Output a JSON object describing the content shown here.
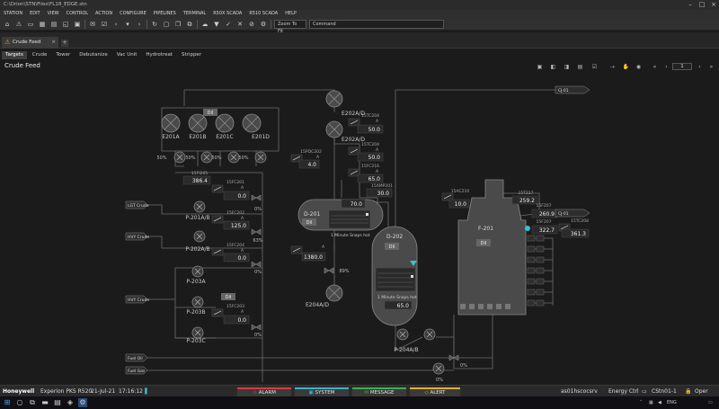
{
  "window": {
    "title": "C:\\Orion\\STN\\Files\\FL18_EDGE.stn"
  },
  "menu": [
    "STATION",
    "EDIT",
    "VIEW",
    "CONTROL",
    "ACTION",
    "CONFIGURE",
    "PIPELINES",
    "TERMINAL",
    "R50X SCADA",
    "R510 SCADA",
    "HELP"
  ],
  "toolbar": {
    "zoom": "Zoom To Fit",
    "command_placeholder": "Command"
  },
  "doc_tab": {
    "label": "Crude Feed"
  },
  "nav_tabs": [
    "Targets",
    "Crude",
    "Tower",
    "Debutanize",
    "Vac Unit",
    "Hydrotreat",
    "Stripper"
  ],
  "page": {
    "title": "Crude Feed",
    "number": "1"
  },
  "colors": {
    "background": "#1b1b1b",
    "line": "#6e6e6e",
    "equipment": "#4a4a4a",
    "value_box": "#2a2a2a",
    "accent_cyan": "#39c1d2",
    "alarm_red": "#d83b3b",
    "system_cyan": "#3bb2c7",
    "message_green": "#3cb04c",
    "alert_yellow": "#e0b030"
  },
  "schematic": {
    "exchangers_e201": [
      {
        "label": "E201A",
        "pct": "50%"
      },
      {
        "label": "E201B",
        "pct": "50%"
      },
      {
        "label": "E201C",
        "pct": "50%"
      },
      {
        "label": "E201D",
        "pct": "50%"
      }
    ],
    "e201_dil": "Dil",
    "tags": {
      "t15fi205": "15FI205",
      "t15fc201": "15FC201",
      "t15fc202": "15FC202",
      "t15fc203": "15FC203",
      "t15fc204": "15FC204",
      "t15pdc202": "15PDC202",
      "t15tc204": "15TC204",
      "t15fc216": "15FC216",
      "t15amp201": "15AMP201",
      "t15ac210": "15AC210",
      "t15t227": "15T227",
      "t15f207": "15F207",
      "t15tc208": "15TC208"
    },
    "values": {
      "fi205": "386.4",
      "fc201": "0.0",
      "fc202": "125.0",
      "fc203": "0.0",
      "fc204": "0.0",
      "pdc202": "4.0",
      "tc204_top": "50.0",
      "tc204_mid": "50.0",
      "fc216": "65.0",
      "amp201": "30.0",
      "d201_level": "70.0",
      "d201_out": "1380.0",
      "d202_level": "65.0",
      "ac210": "10.0",
      "t227": "259.2",
      "f_a": "260.9",
      "f_b": "322.7",
      "tc208": "361.3"
    },
    "pcts": {
      "fc201_out": "0%",
      "fc202_out": "63%",
      "fc204_out": "0%",
      "fc203_out": "0%",
      "d201_valve": "89%",
      "fuel_oil": "0%",
      "fuel_gas": "0%"
    },
    "ab": "A",
    "inlets": [
      "LGT Crude",
      "HVY Crude",
      "HVY Crude"
    ],
    "pumps": [
      "P-201A/B",
      "P-202A/B",
      "P-203A",
      "P-203B",
      "P-203C",
      "P-204A/B"
    ],
    "p203_dil": "Dil",
    "e202a": "E202A/D",
    "e202b": "E202A/D",
    "e204": "E204A/D",
    "d201": {
      "label": "D-201",
      "dil": "Dil",
      "trend": "1 Minute Snaps hot"
    },
    "d202": {
      "label": "D-202",
      "dil": "Dil",
      "trend": "1 Minute Snaps hot"
    },
    "f201": {
      "label": "F-201",
      "dil": "Dil"
    },
    "offpage": [
      "CJ-01",
      "CJ-01"
    ],
    "fuel": [
      "Fuel Oil",
      "Fuel Gas"
    ]
  },
  "statusbar": {
    "brand": "Honeywell",
    "product": "Experion PKS R520",
    "date": "21-Jul-21",
    "time": "17:16:12",
    "alarm": "ALARM",
    "system": "SYSTEM",
    "message": "MESSAGE",
    "alert": "ALERT",
    "operator": "as01hscocsrv",
    "asset": "Energy Ctrl",
    "station": "CStn01-1",
    "mode": "Oper"
  },
  "taskbar": {
    "lang": "ENG"
  }
}
